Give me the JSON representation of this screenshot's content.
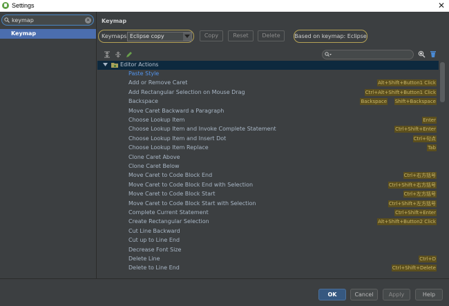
{
  "window": {
    "title": "Settings",
    "app_icon": "android-studio-icon",
    "close_glyph": "✕"
  },
  "sidebar": {
    "search": {
      "value": "keymap",
      "placeholder": "",
      "clear_glyph": "×"
    },
    "items": [
      {
        "label": "Keymap",
        "selected": true
      }
    ]
  },
  "main": {
    "title": "Keymap",
    "keymaps_label": "Keymaps:",
    "keymap_selected": "Eclipse copy",
    "buttons": {
      "copy": "Copy",
      "reset": "Reset",
      "delete": "Delete"
    },
    "based_on": "Based on keymap: Eclipse",
    "toolbar_icons": [
      "expand-all-icon",
      "collapse-all-icon",
      "edit-icon",
      "find-shortcut-icon",
      "clear-filter-icon"
    ],
    "filter_search": {
      "value": "",
      "placeholder": ""
    }
  },
  "tree": {
    "group": "Editor Actions",
    "actions": [
      {
        "name": "Paste Style",
        "shortcuts": []
      },
      {
        "name": "Add or Remove Caret",
        "shortcuts": [
          "Alt+Shift+Button1 Click"
        ]
      },
      {
        "name": "Add Rectangular Selection on Mouse Drag",
        "shortcuts": [
          "Ctrl+Alt+Shift+Button1 Click"
        ]
      },
      {
        "name": "Backspace",
        "shortcuts": [
          "Backspace",
          "Shift+Backspace"
        ]
      },
      {
        "name": "Move Caret Backward a Paragraph",
        "shortcuts": []
      },
      {
        "name": "Choose Lookup Item",
        "shortcuts": [
          "Enter"
        ]
      },
      {
        "name": "Choose Lookup Item and Invoke Complete Statement",
        "shortcuts": [
          "Ctrl+Shift+Enter"
        ]
      },
      {
        "name": "Choose Lookup Item and Insert Dot",
        "shortcuts": [
          "Ctrl+句点"
        ]
      },
      {
        "name": "Choose Lookup Item Replace",
        "shortcuts": [
          "Tab"
        ]
      },
      {
        "name": "Clone Caret Above",
        "shortcuts": []
      },
      {
        "name": "Clone Caret Below",
        "shortcuts": []
      },
      {
        "name": "Move Caret to Code Block End",
        "shortcuts": [
          "Ctrl+右方括号"
        ]
      },
      {
        "name": "Move Caret to Code Block End with Selection",
        "shortcuts": [
          "Ctrl+Shift+右方括号"
        ]
      },
      {
        "name": "Move Caret to Code Block Start",
        "shortcuts": [
          "Ctrl+左方括号"
        ]
      },
      {
        "name": "Move Caret to Code Block Start with Selection",
        "shortcuts": [
          "Ctrl+Shift+左方括号"
        ]
      },
      {
        "name": "Complete Current Statement",
        "shortcuts": [
          "Ctrl+Shift+Enter"
        ]
      },
      {
        "name": "Create Rectangular Selection",
        "shortcuts": [
          "Alt+Shift+Button2 Click"
        ]
      },
      {
        "name": "Cut Line Backward",
        "shortcuts": []
      },
      {
        "name": "Cut up to Line End",
        "shortcuts": []
      },
      {
        "name": "Decrease Font Size",
        "shortcuts": []
      },
      {
        "name": "Delete Line",
        "shortcuts": [
          "Ctrl+D"
        ]
      },
      {
        "name": "Delete to Line End",
        "shortcuts": [
          "Ctrl+Shift+Delete"
        ]
      }
    ]
  },
  "footer": {
    "ok": "OK",
    "cancel": "Cancel",
    "apply": "Apply",
    "help": "Help"
  },
  "colors": {
    "accent": "#4b6eaf",
    "highlight_border": "#b5a256",
    "shortcut_bg": "#5c4f1d",
    "shortcut_text": "#c9b76b",
    "paste_style_text": "#5394ec"
  }
}
